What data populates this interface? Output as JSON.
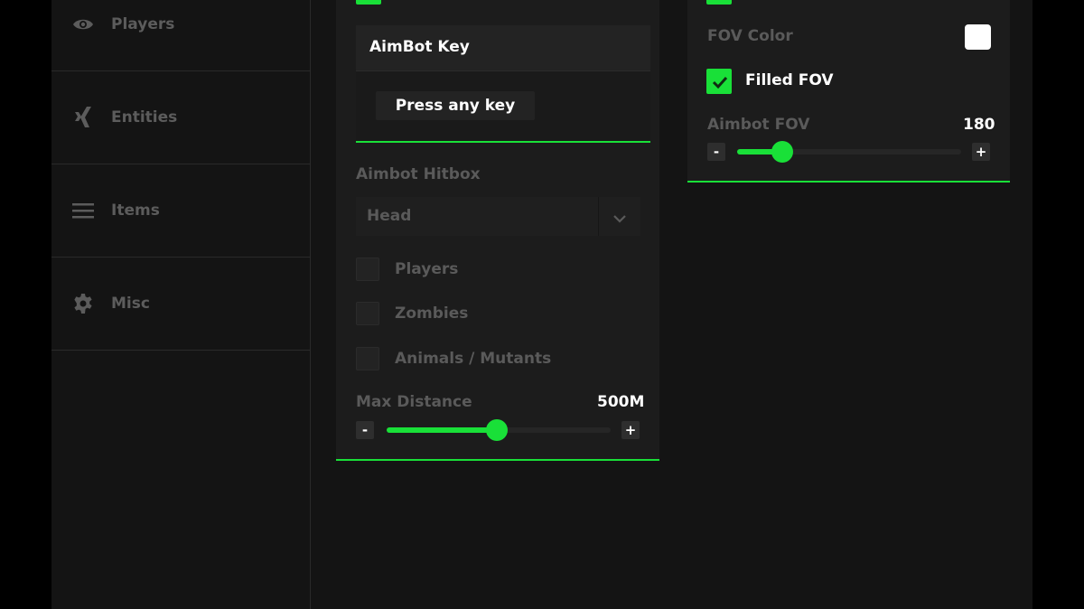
{
  "sidebar": {
    "items": [
      {
        "label": "Players",
        "icon": "eye-icon"
      },
      {
        "label": "Entities",
        "icon": "xing-icon"
      },
      {
        "label": "Items",
        "icon": "menu-icon"
      },
      {
        "label": "Misc",
        "icon": "gear-icon"
      }
    ]
  },
  "aimbot_key": {
    "title": "AimBot Key",
    "button": "Press any key"
  },
  "hitbox": {
    "label": "Aimbot Hitbox",
    "selected": "Head"
  },
  "targets": [
    {
      "label": "Players",
      "checked": false
    },
    {
      "label": "Zombies",
      "checked": false
    },
    {
      "label": "Animals / Mutants",
      "checked": false
    }
  ],
  "max_distance": {
    "label": "Max Distance",
    "value": "500M",
    "minus": "-",
    "plus": "+",
    "fraction": 0.49
  },
  "fov": {
    "color_label": "FOV Color",
    "color": "#ffffff",
    "filled_label": "Filled FOV",
    "filled_checked": true,
    "aimbot_fov_label": "Aimbot FOV",
    "aimbot_fov_value": "180",
    "minus": "-",
    "plus": "+",
    "fraction": 0.2
  },
  "colors": {
    "accent": "#19e038",
    "panel": "#1c1c1c",
    "background": "#141414"
  }
}
